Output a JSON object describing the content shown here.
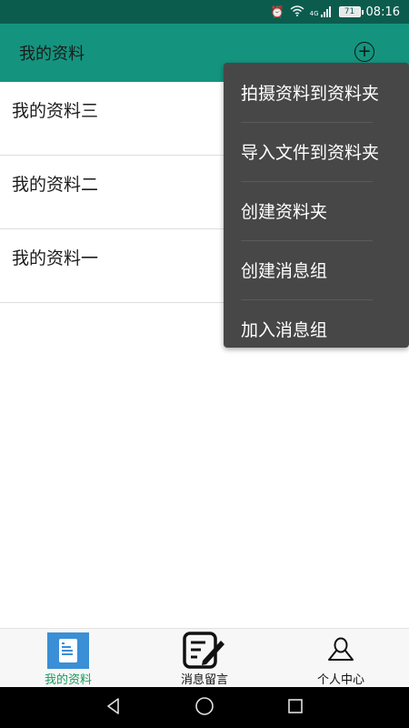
{
  "status_bar": {
    "signal_label": "4G",
    "battery_level": "71",
    "time": "08:16"
  },
  "app_bar": {
    "title": "我的资料",
    "add_icon": "plus-circle-icon"
  },
  "list": {
    "items": [
      {
        "label": "我的资料三"
      },
      {
        "label": "我的资料二"
      },
      {
        "label": "我的资料一"
      }
    ]
  },
  "menu": {
    "items": [
      {
        "label": "拍摄资料到资料夹"
      },
      {
        "label": "导入文件到资料夹"
      },
      {
        "label": "创建资料夹"
      },
      {
        "label": "创建消息组"
      },
      {
        "label": "加入消息组"
      }
    ]
  },
  "tabs": [
    {
      "label": "我的资料",
      "icon": "document-icon",
      "active": true
    },
    {
      "label": "消息留言",
      "icon": "edit-note-icon",
      "active": false
    },
    {
      "label": "个人中心",
      "icon": "person-icon",
      "active": false
    }
  ],
  "colors": {
    "status_bar": "#0c5c4e",
    "app_bar": "#14947e",
    "menu_bg": "#474747",
    "tab_active": "#1a9a5a",
    "tab_icon_active": "#3a8fd6"
  }
}
